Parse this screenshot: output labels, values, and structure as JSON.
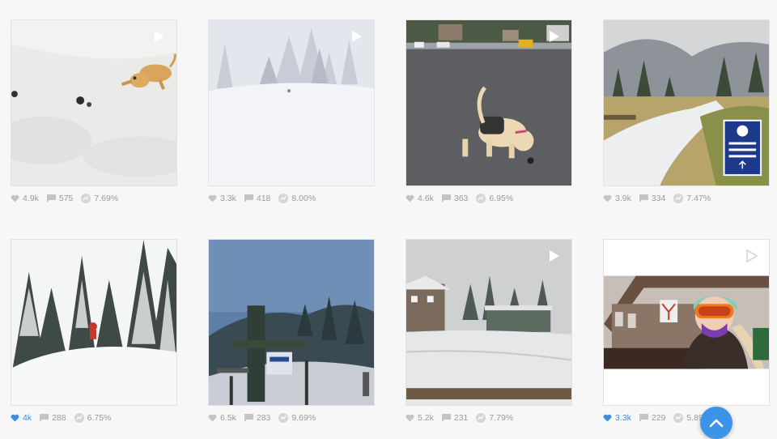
{
  "colors": {
    "accent": "#3b94e8",
    "like_active": "#3b8fd9",
    "stat_text": "#9a9a9a",
    "background": "#f7f7f7"
  },
  "posts": [
    {
      "likes": "4.9k",
      "comments": "575",
      "engagement": "7.69%",
      "video": true,
      "liked": false,
      "scene": "puppy in snow"
    },
    {
      "likes": "3.3k",
      "comments": "418",
      "engagement": "8.00%",
      "video": true,
      "liked": false,
      "scene": "snowy pine trees"
    },
    {
      "likes": "4.6k",
      "comments": "363",
      "engagement": "6.95%",
      "video": true,
      "liked": false,
      "scene": "puppy in parking lot"
    },
    {
      "likes": "3.9k",
      "comments": "334",
      "engagement": "7.47%",
      "video": false,
      "liked": false,
      "scene": "snowy mountain path with sign"
    },
    {
      "likes": "4k",
      "comments": "288",
      "engagement": "6.75%",
      "video": false,
      "liked": true,
      "scene": "skier in snowy trees"
    },
    {
      "likes": "6.5k",
      "comments": "283",
      "engagement": "9.69%",
      "video": false,
      "liked": false,
      "scene": "chairlift in snow"
    },
    {
      "likes": "5.2k",
      "comments": "231",
      "engagement": "7.79%",
      "video": true,
      "liked": false,
      "scene": "lodge in snow"
    },
    {
      "likes": "3.3k",
      "comments": "229",
      "engagement": "5.89%",
      "video": true,
      "liked": true,
      "scene": "selfie at ski shop"
    }
  ],
  "icons": {
    "like": "heart-icon",
    "comment": "comment-icon",
    "engagement": "engagement-icon",
    "play": "play-icon",
    "scroll_top": "chevron-up-icon"
  }
}
